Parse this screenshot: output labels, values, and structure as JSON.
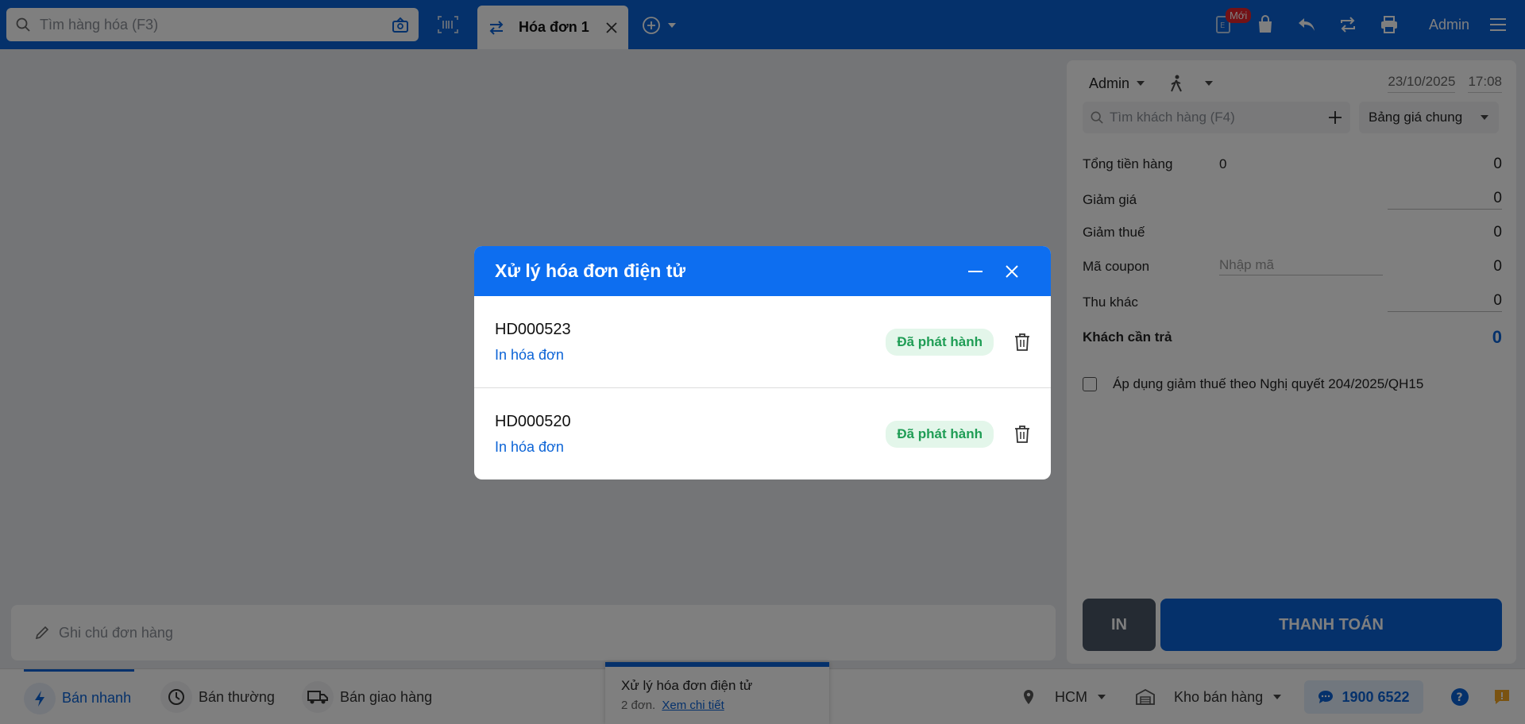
{
  "topbar": {
    "search_placeholder": "Tìm hàng hóa (F3)",
    "tab_title": "Hóa đơn 1",
    "new_badge": "Mới",
    "user": "Admin"
  },
  "note": {
    "placeholder": "Ghi chú đơn hàng"
  },
  "panel": {
    "seller": "Admin",
    "date": "23/10/2025",
    "time": "17:08",
    "customer_search_placeholder": "Tìm khách hàng (F4)",
    "price_list": "Bảng giá chung",
    "rows": {
      "total_goods_label": "Tổng tiền hàng",
      "total_goods_qty": "0",
      "total_goods_value": "0",
      "discount_label": "Giảm giá",
      "discount_value": "0",
      "tax_reduction_label": "Giảm thuế",
      "tax_reduction_value": "0",
      "coupon_label": "Mã coupon",
      "coupon_placeholder": "Nhập mã",
      "coupon_value": "0",
      "other_income_label": "Thu khác",
      "other_income_value": "0",
      "customer_pay_label": "Khách cần trả",
      "customer_pay_value": "0"
    },
    "tax_checkbox_label": "Áp dụng giảm thuế theo Nghị quyết 204/2025/QH15",
    "print_button": "IN",
    "pay_button": "THANH TOÁN"
  },
  "bottombar": {
    "quick_sale": "Bán nhanh",
    "normal_sale": "Bán thường",
    "delivery_sale": "Bán giao hàng",
    "location": "HCM",
    "warehouse": "Kho bán hàng",
    "hotline": "1900 6522"
  },
  "toast": {
    "title": "Xử lý hóa đơn điện tử",
    "count_text": "2 đơn.",
    "detail_link": "Xem chi tiết"
  },
  "modal": {
    "title": "Xử lý hóa đơn điện tử",
    "invoices": [
      {
        "code": "HD000523",
        "link": "In hóa đơn",
        "status": "Đã phát hành"
      },
      {
        "code": "HD000520",
        "link": "In hóa đơn",
        "status": "Đã phát hành"
      }
    ]
  },
  "colors": {
    "brand": "#0b63d6",
    "modal_header": "#0d6ef0",
    "status_bg": "#e3f6ea",
    "status_text": "#1f9d55",
    "print_button": "#4a5766"
  }
}
